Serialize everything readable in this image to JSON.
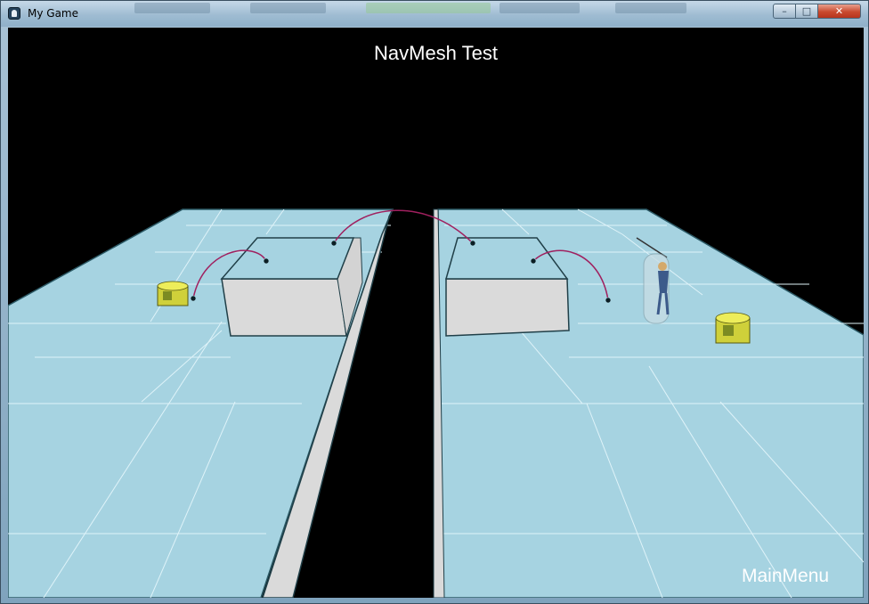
{
  "window": {
    "title": "My Game",
    "controls": {
      "minimize": "–",
      "maximize": "□",
      "close": "✕"
    }
  },
  "hud": {
    "title": "NavMesh Test",
    "main_menu": "MainMenu"
  },
  "scene": {
    "floor_color": "#a6d3e1",
    "grid_color": "#dff3f9",
    "block_color": "#d9d9d9",
    "jump_link_color": "#a0205f",
    "crate_color": "#d8d83a",
    "background": "#000000"
  }
}
